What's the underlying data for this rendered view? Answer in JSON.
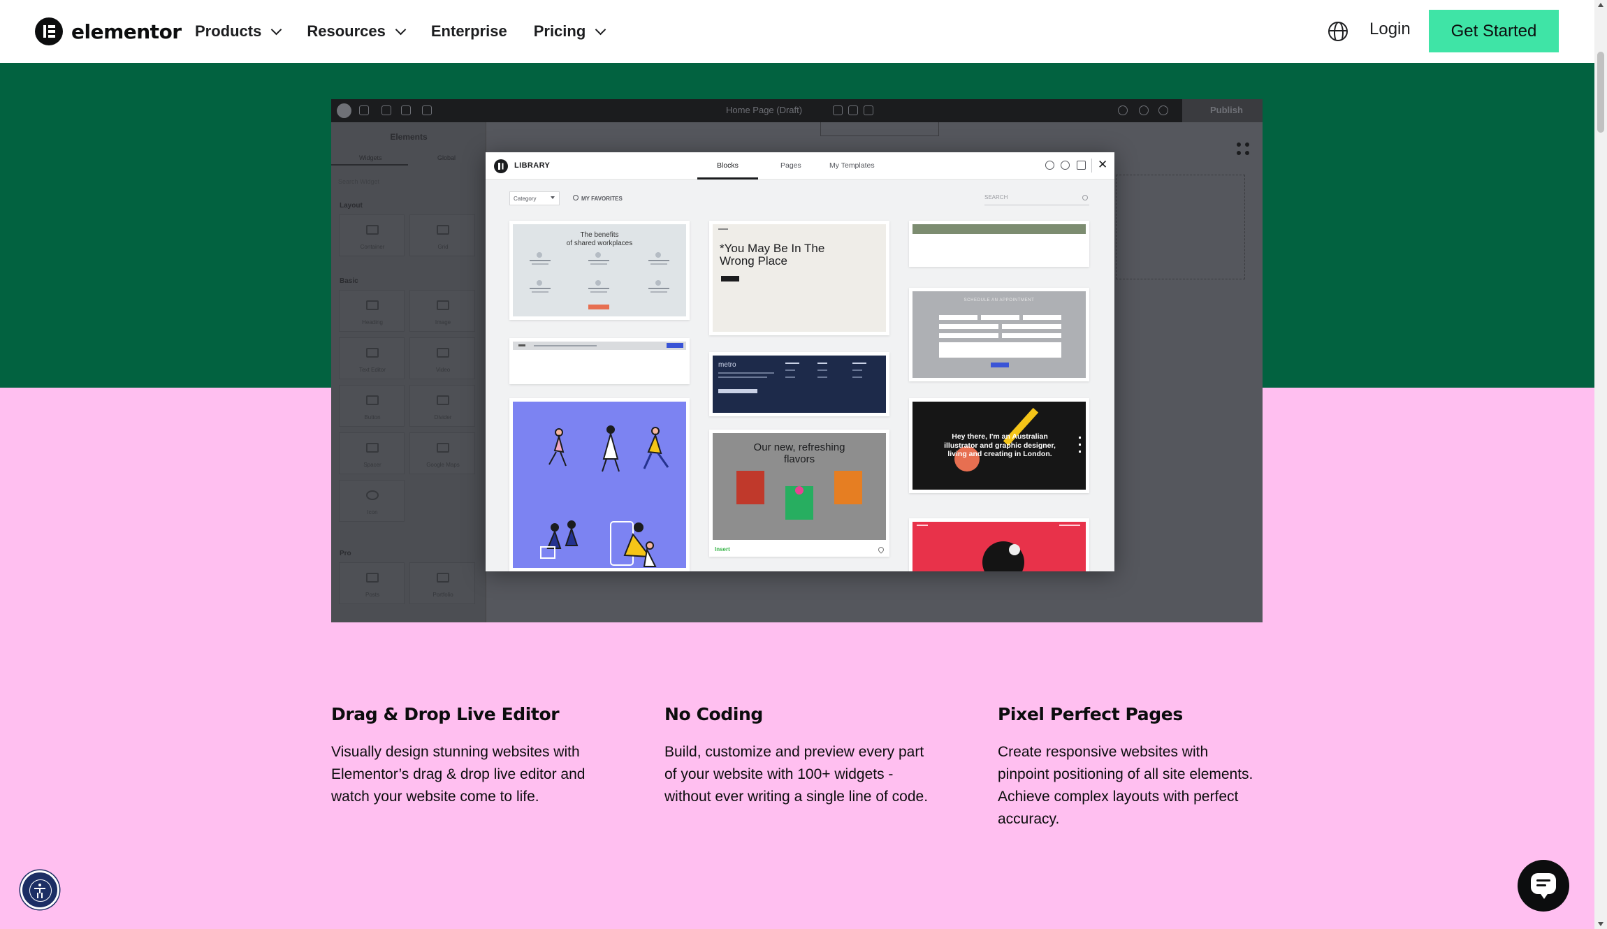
{
  "brand": {
    "name": "elementor",
    "accent": "#3fe4a6",
    "green_band": "#026240",
    "pink_bg": "#ffbff0"
  },
  "header": {
    "nav": [
      {
        "label": "Products",
        "has_dropdown": true
      },
      {
        "label": "Resources",
        "has_dropdown": true
      },
      {
        "label": "Enterprise",
        "has_dropdown": false
      },
      {
        "label": "Pricing",
        "has_dropdown": true
      }
    ],
    "login_label": "Login",
    "cta_label": "Get Started",
    "language_icon": "globe-icon"
  },
  "editor": {
    "page_title": "Home Page (Draft)",
    "publish_label": "Publish",
    "sidebar": {
      "title": "Elements",
      "tabs": [
        "Widgets",
        "Global"
      ],
      "search_placeholder": "Search Widget",
      "sections": [
        {
          "name": "Layout",
          "widgets": [
            "Container",
            "Grid"
          ]
        },
        {
          "name": "Basic",
          "widgets": [
            "Heading",
            "Image",
            "Text Editor",
            "Video",
            "Button",
            "Divider",
            "Spacer",
            "Google Maps",
            "Icon"
          ]
        },
        {
          "name": "Pro",
          "widgets": [
            "Posts",
            "Portfolio"
          ]
        }
      ]
    }
  },
  "library": {
    "title": "LIBRARY",
    "tabs": [
      {
        "label": "Blocks",
        "active": true
      },
      {
        "label": "Pages",
        "active": false
      },
      {
        "label": "My Templates",
        "active": false
      }
    ],
    "category_placeholder": "Category",
    "favorites_label": "MY FAVORITES",
    "search_placeholder": "SEARCH",
    "templates": {
      "shared_workplaces": "The benefits\nof shared workplaces",
      "wrong_place": "*You May Be In The\n Wrong Place",
      "metro": "metro",
      "flavors": "Our new, refreshing\nflavors",
      "illustrator": "Hey there, I'm an Australian illustrator and graphic designer, living and creating in London.",
      "appointment": "SCHEDULE AN APPOINTMENT",
      "insert_label": "Insert"
    }
  },
  "features": [
    {
      "title": "Drag & Drop Live Editor",
      "text": "Visually design stunning websites with Elementor’s drag & drop live editor and watch your website come to life."
    },
    {
      "title": "No Coding",
      "text": "Build, customize and preview every part of your website with 100+ widgets - without ever writing a single line of code."
    },
    {
      "title": "Pixel Perfect Pages",
      "text": "Create responsive websites with pinpoint positioning of all site elements. Achieve complex layouts with perfect accuracy."
    }
  ]
}
